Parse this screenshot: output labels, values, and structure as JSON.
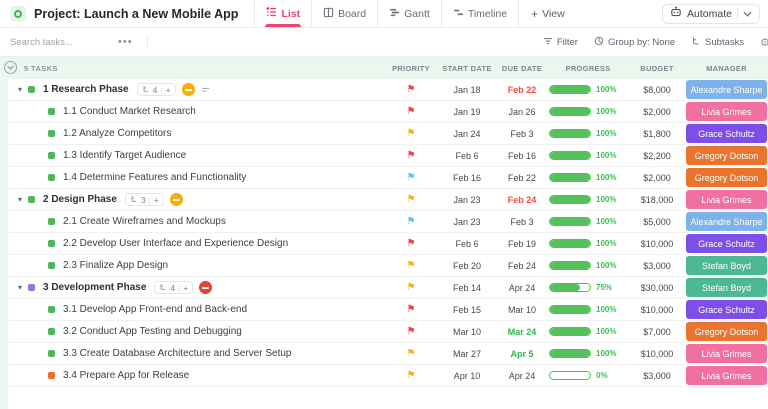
{
  "header": {
    "title": "Project: Launch a New Mobile App",
    "tabs": [
      {
        "label": "List",
        "active": true
      },
      {
        "label": "Board",
        "active": false
      },
      {
        "label": "Gantt",
        "active": false
      },
      {
        "label": "Timeline",
        "active": false
      }
    ],
    "add_view_label": "View",
    "automate_label": "Automate"
  },
  "toolbar": {
    "search_placeholder": "Search tasks...",
    "filter_label": "Filter",
    "group_by_label": "Group by: None",
    "subtasks_label": "Subtasks"
  },
  "table": {
    "tasks_count_label": "5 TASKS",
    "columns": [
      "PRIORITY",
      "START DATE",
      "DUE DATE",
      "PROGRESS",
      "BUDGET",
      "MANAGER"
    ],
    "rows": [
      {
        "type": "group",
        "name": "1 Research Phase",
        "status": "green",
        "subtask_count": "4",
        "group_status": "yellow",
        "has_notes_icon": true,
        "priority": "red",
        "start_date": "Jan 18",
        "due_date": "Feb 22",
        "due_state": "red",
        "progress": 100,
        "budget": "$8,000",
        "manager": "Alexandre Sharpe"
      },
      {
        "type": "child",
        "name": "1.1 Conduct Market Research",
        "status": "green",
        "priority": "red",
        "start_date": "Jan 19",
        "due_date": "Jan 26",
        "progress": 100,
        "budget": "$2,000",
        "manager": "Livia Grimes"
      },
      {
        "type": "child",
        "name": "1.2 Analyze Competitors",
        "status": "green",
        "priority": "yellow",
        "start_date": "Jan 24",
        "due_date": "Feb 3",
        "progress": 100,
        "budget": "$1,800",
        "manager": "Grace Schultz"
      },
      {
        "type": "child",
        "name": "1.3 Identify Target Audience",
        "status": "green",
        "priority": "red",
        "start_date": "Feb 6",
        "due_date": "Feb 16",
        "progress": 100,
        "budget": "$2,200",
        "manager": "Gregory Dotson"
      },
      {
        "type": "child",
        "name": "1.4 Determine Features and Functionality",
        "status": "green",
        "priority": "blue",
        "start_date": "Feb 16",
        "due_date": "Feb 22",
        "progress": 100,
        "budget": "$2,000",
        "manager": "Gregory Dotson"
      },
      {
        "type": "group",
        "name": "2 Design Phase",
        "status": "green",
        "subtask_count": "3",
        "group_status": "yellow",
        "priority": "yellow",
        "start_date": "Jan 23",
        "due_date": "Feb 24",
        "due_state": "red",
        "progress": 100,
        "budget": "$18,000",
        "manager": "Livia Grimes"
      },
      {
        "type": "child",
        "name": "2.1 Create Wireframes and Mockups",
        "status": "green",
        "priority": "blue",
        "start_date": "Jan 23",
        "due_date": "Feb 3",
        "progress": 100,
        "budget": "$5,000",
        "manager": "Alexandre Sharpe"
      },
      {
        "type": "child",
        "name": "2.2 Develop User Interface and Experience Design",
        "status": "green",
        "priority": "red",
        "start_date": "Feb 6",
        "due_date": "Feb 19",
        "progress": 100,
        "budget": "$10,000",
        "manager": "Grace Schultz"
      },
      {
        "type": "child",
        "name": "2.3 Finalize App Design",
        "status": "green",
        "priority": "yellow",
        "start_date": "Feb 20",
        "due_date": "Feb 24",
        "progress": 100,
        "budget": "$3,000",
        "manager": "Stefan Boyd"
      },
      {
        "type": "group",
        "name": "3 Development Phase",
        "status": "purple",
        "subtask_count": "4",
        "group_status": "red",
        "priority": "yellow",
        "start_date": "Feb 14",
        "due_date": "Apr 24",
        "progress": 75,
        "budget": "$30,000",
        "manager": "Stefan Boyd"
      },
      {
        "type": "child",
        "name": "3.1 Develop App Front-end and Back-end",
        "status": "green",
        "priority": "red",
        "start_date": "Feb 15",
        "due_date": "Mar 10",
        "progress": 100,
        "budget": "$10,000",
        "manager": "Grace Schultz"
      },
      {
        "type": "child",
        "name": "3.2 Conduct App Testing and Debugging",
        "status": "green",
        "priority": "red",
        "start_date": "Mar 10",
        "due_date": "Mar 24",
        "due_state": "green",
        "progress": 100,
        "budget": "$7,000",
        "manager": "Gregory Dotson"
      },
      {
        "type": "child",
        "name": "3.3 Create Database Architecture and Server Setup",
        "status": "green",
        "priority": "yellow",
        "start_date": "Mar 27",
        "due_date": "Apr 5",
        "due_state": "green",
        "progress": 100,
        "budget": "$10,000",
        "manager": "Livia Grimes"
      },
      {
        "type": "child",
        "name": "3.4 Prepare App for Release",
        "status": "orange",
        "priority": "yellow",
        "start_date": "Apr 10",
        "due_date": "Apr 24",
        "progress": 0,
        "budget": "$3,000",
        "manager": "Livia Grimes"
      }
    ]
  },
  "colors": {
    "accent": "#ee476d",
    "progress": "#55c15d",
    "status": {
      "green": "#4fb65a",
      "purple": "#a06bea",
      "orange": "#ed6d2d"
    },
    "priority": {
      "red": "#f4414f",
      "yellow": "#f6b30e",
      "blue": "#5bc5f2"
    },
    "due": {
      "red": "#fb493f",
      "green": "#2eb84b"
    },
    "group_status": {
      "yellow": "#f5ae0a",
      "red": "#e04536"
    },
    "manager": {
      "Alexandre Sharpe": "#7fb1ea",
      "Livia Grimes": "#f0719f",
      "Grace Schultz": "#7d4fe8",
      "Gregory Dotson": "#e8742d",
      "Stefan Boyd": "#4cb894"
    }
  }
}
